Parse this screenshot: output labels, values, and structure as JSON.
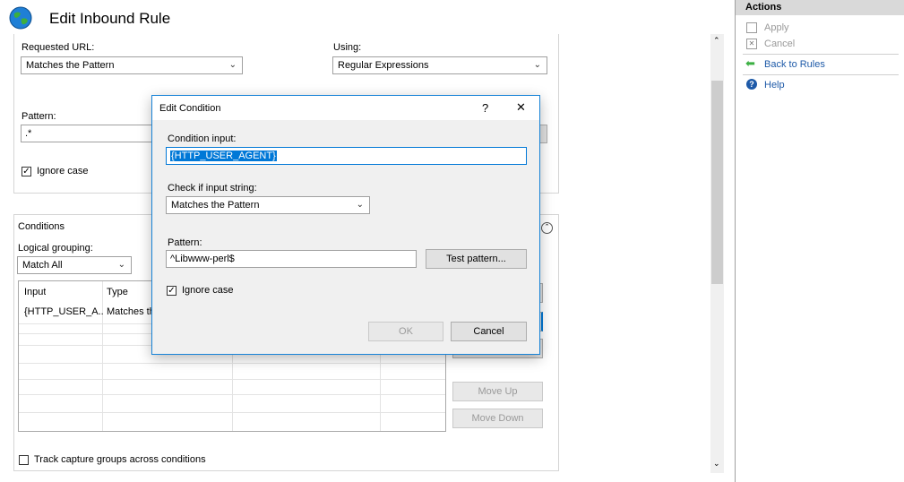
{
  "window": {
    "title": "Edit Inbound Rule"
  },
  "form": {
    "requested_url_label": "Requested URL:",
    "requested_url_value": "Matches the Pattern",
    "using_label": "Using:",
    "using_value": "Regular Expressions",
    "pattern_label": "Pattern:",
    "pattern_value": ".*",
    "ignore_case_label": "Ignore case"
  },
  "conditions": {
    "title": "Conditions",
    "logical_grouping_label": "Logical grouping:",
    "logical_grouping_value": "Match All",
    "columns": [
      "Input",
      "Type"
    ],
    "rows": [
      {
        "input": "{HTTP_USER_A...",
        "type": "Matches th"
      }
    ],
    "move_up": "Move Up",
    "move_down": "Move Down",
    "track_capture_label": "Track capture groups across conditions"
  },
  "dialog": {
    "title": "Edit Condition",
    "help": "?",
    "close": "✕",
    "condition_input_label": "Condition input:",
    "condition_input_value": "{HTTP_USER_AGENT}",
    "check_if_label": "Check if input string:",
    "check_if_value": "Matches the Pattern",
    "pattern_label": "Pattern:",
    "pattern_value": "^Libwww-perl$",
    "test_pattern": "Test pattern...",
    "ignore_case_label": "Ignore case",
    "ok": "OK",
    "cancel": "Cancel"
  },
  "actions": {
    "header": "Actions",
    "apply": "Apply",
    "cancel": "Cancel",
    "back_to_rules": "Back to Rules",
    "help": "Help"
  },
  "colors": {
    "accent": "#0078d7",
    "link": "#1e5aa8",
    "back_arrow": "#3cb043"
  }
}
